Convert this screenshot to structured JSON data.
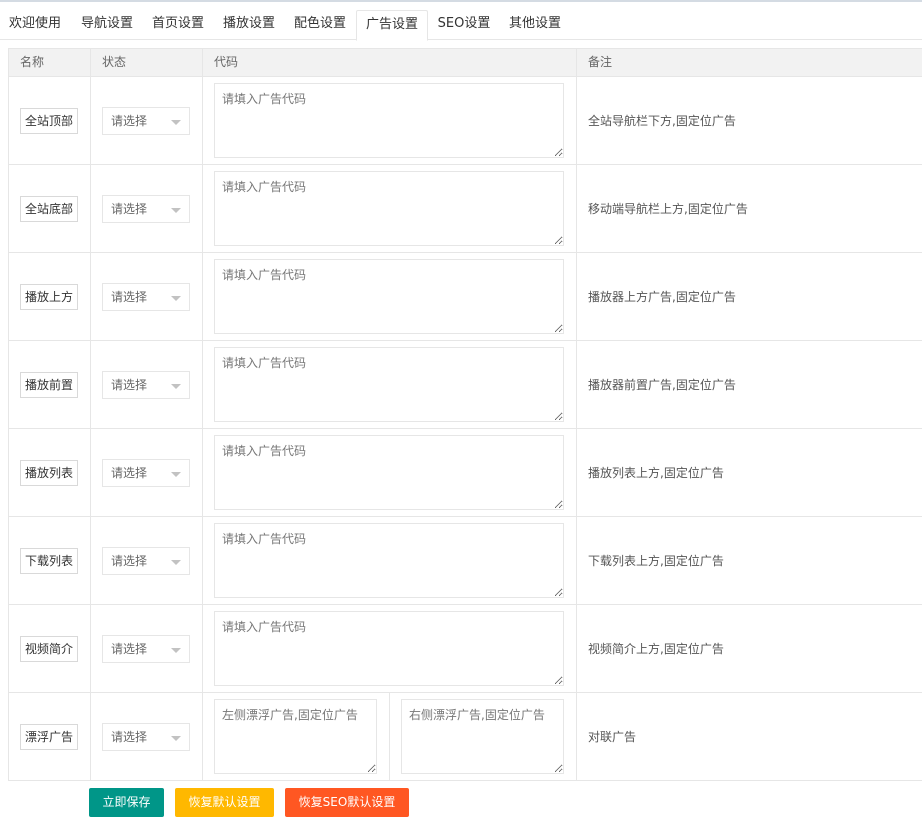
{
  "tabs": [
    {
      "label": "欢迎使用"
    },
    {
      "label": "导航设置"
    },
    {
      "label": "首页设置"
    },
    {
      "label": "播放设置"
    },
    {
      "label": "配色设置"
    },
    {
      "label": "广告设置",
      "active": true
    },
    {
      "label": "SEO设置"
    },
    {
      "label": "其他设置"
    }
  ],
  "table": {
    "headers": [
      "名称",
      "状态",
      "代码",
      "备注"
    ],
    "select_placeholder": "请选择",
    "code_placeholder": "请填入广告代码",
    "rows": [
      {
        "name": "全站顶部",
        "note": "全站导航栏下方,固定位广告"
      },
      {
        "name": "全站底部",
        "note": "移动端导航栏上方,固定位广告"
      },
      {
        "name": "播放上方",
        "note": "播放器上方广告,固定位广告"
      },
      {
        "name": "播放前置",
        "note": "播放器前置广告,固定位广告"
      },
      {
        "name": "播放列表",
        "note": "播放列表上方,固定位广告"
      },
      {
        "name": "下载列表",
        "note": "下载列表上方,固定位广告"
      },
      {
        "name": "视频简介",
        "note": "视频简介上方,固定位广告"
      }
    ],
    "float_row": {
      "name": "漂浮广告",
      "left_placeholder": "左侧漂浮广告,固定位广告",
      "right_placeholder": "右侧漂浮广告,固定位广告",
      "note": "对联广告"
    }
  },
  "buttons": {
    "save": "立即保存",
    "reset": "恢复默认设置",
    "reset_seo": "恢复SEO默认设置"
  },
  "colors": {
    "save": "#009688",
    "reset": "#ffb800",
    "reset_seo": "#ff5722"
  }
}
